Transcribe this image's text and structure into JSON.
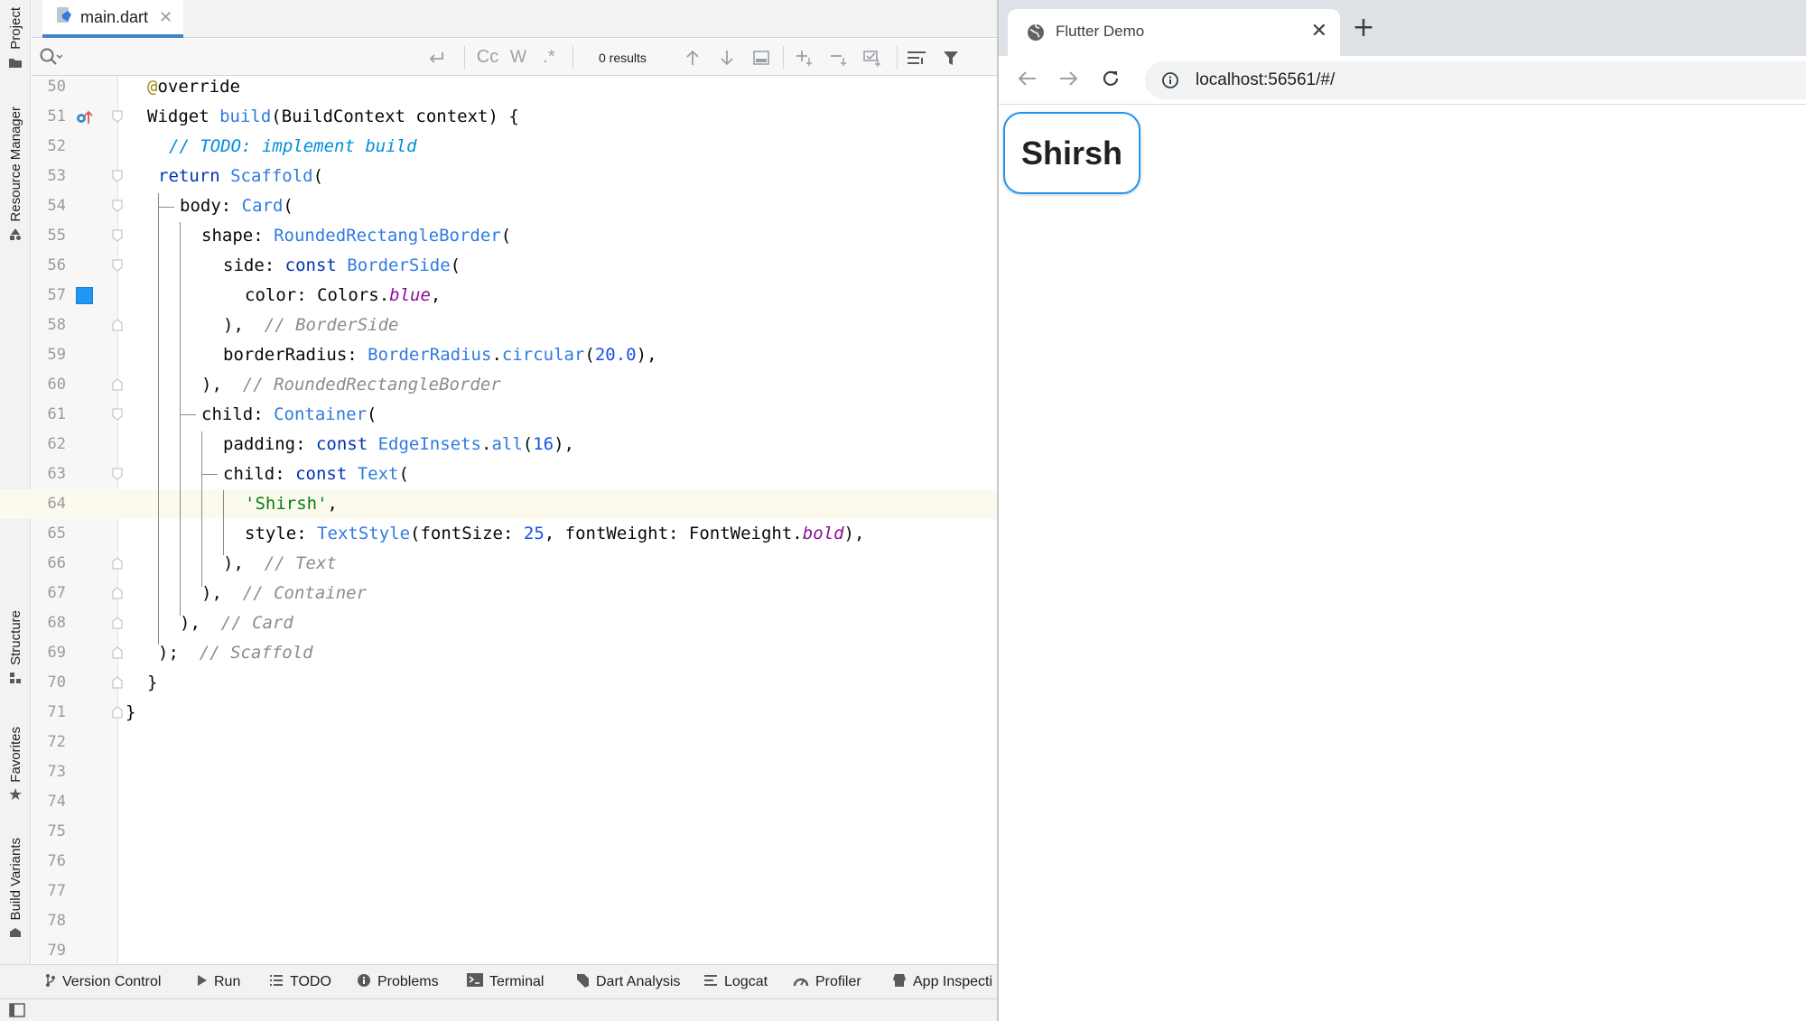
{
  "ide": {
    "left_strip": {
      "project": "Project",
      "resource_manager": "Resource Manager",
      "structure": "Structure",
      "favorites": "Favorites",
      "build_variants": "Build Variants"
    },
    "file_tab": {
      "name": "main.dart"
    },
    "search": {
      "placeholder": "",
      "results": "0 results",
      "match_case": "Cc",
      "words": "W",
      "regex": ".*"
    },
    "editor": {
      "lines": [
        {
          "num": "50"
        },
        {
          "num": "51"
        },
        {
          "num": "52"
        },
        {
          "num": "53"
        },
        {
          "num": "54"
        },
        {
          "num": "55"
        },
        {
          "num": "56"
        },
        {
          "num": "57"
        },
        {
          "num": "58"
        },
        {
          "num": "59"
        },
        {
          "num": "60"
        },
        {
          "num": "61"
        },
        {
          "num": "62"
        },
        {
          "num": "63"
        },
        {
          "num": "64"
        },
        {
          "num": "65"
        },
        {
          "num": "66"
        },
        {
          "num": "67"
        },
        {
          "num": "68"
        },
        {
          "num": "69"
        },
        {
          "num": "70"
        },
        {
          "num": "71"
        },
        {
          "num": "72"
        },
        {
          "num": "73"
        },
        {
          "num": "74"
        },
        {
          "num": "75"
        },
        {
          "num": "76"
        },
        {
          "num": "77"
        },
        {
          "num": "78"
        },
        {
          "num": "79"
        }
      ],
      "code": {
        "l50_anno": "@",
        "l50_rest": "override",
        "l51_a": "Widget ",
        "l51_b": "build",
        "l51_c": "(BuildContext context) {",
        "l52": "// TODO: implement build",
        "l53_a": "return ",
        "l53_b": "Scaffold",
        "l53_c": "(",
        "l54_a": "body: ",
        "l54_b": "Card",
        "l54_c": "(",
        "l55_a": "shape: ",
        "l55_b": "RoundedRectangleBorder",
        "l55_c": "(",
        "l56_a": "side: ",
        "l56_b": "const ",
        "l56_c": "BorderSide",
        "l56_d": "(",
        "l57_a": "color: Colors.",
        "l57_b": "blue",
        "l57_c": ",",
        "l58_a": "),  ",
        "l58_b": "// BorderSide",
        "l59_a": "borderRadius: ",
        "l59_b": "BorderRadius",
        "l59_c": ".",
        "l59_d": "circular",
        "l59_e": "(",
        "l59_f": "20.0",
        "l59_g": "),",
        "l60_a": "),  ",
        "l60_b": "// RoundedRectangleBorder",
        "l61_a": "child: ",
        "l61_b": "Container",
        "l61_c": "(",
        "l62_a": "padding: ",
        "l62_b": "const ",
        "l62_c": "EdgeInsets",
        "l62_d": ".",
        "l62_e": "all",
        "l62_f": "(",
        "l62_g": "16",
        "l62_h": "),",
        "l63_a": "child: ",
        "l63_b": "const ",
        "l63_c": "Text",
        "l63_d": "(",
        "l64_a": "'Shirsh'",
        "l64_b": ",",
        "l65_a": "style: ",
        "l65_b": "TextStyle",
        "l65_c": "(fontSize: ",
        "l65_d": "25",
        "l65_e": ", fontWeight: FontWeight.",
        "l65_f": "bold",
        "l65_g": "),",
        "l66_a": "),  ",
        "l66_b": "// Text",
        "l67_a": "),  ",
        "l67_b": "// Container",
        "l68_a": "),  ",
        "l68_b": "// Card",
        "l69_a": ");  ",
        "l69_b": "// Scaffold",
        "l70": "}",
        "l71": "}"
      },
      "color_swatch": "#2196f3"
    },
    "status_bar": [
      {
        "label": "Version Control",
        "icon": "branch-icon"
      },
      {
        "label": "Run",
        "icon": "run-icon"
      },
      {
        "label": "TODO",
        "icon": "list-icon"
      },
      {
        "label": "Problems",
        "icon": "info-icon"
      },
      {
        "label": "Terminal",
        "icon": "terminal-icon"
      },
      {
        "label": "Dart Analysis",
        "icon": "dart-icon"
      },
      {
        "label": "Logcat",
        "icon": "logcat-icon"
      },
      {
        "label": "Profiler",
        "icon": "gauge-icon"
      },
      {
        "label": "App Inspecti",
        "icon": "inspector-icon"
      }
    ]
  },
  "browser": {
    "tab_title": "Flutter Demo",
    "url": "localhost:56561/#/",
    "app": {
      "card_text": "Shirsh",
      "border_color": "#2196f3"
    }
  }
}
